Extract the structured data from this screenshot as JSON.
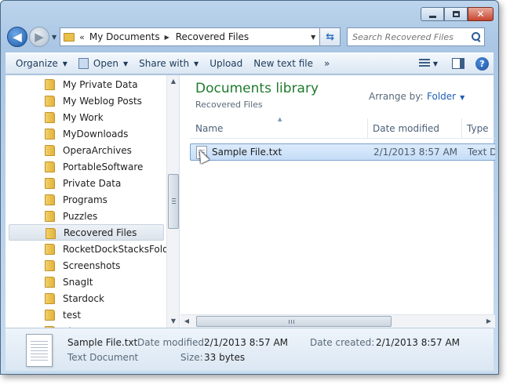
{
  "window": {
    "close_glyph": "✕"
  },
  "address": {
    "overflow": "«",
    "segments": [
      "My Documents",
      "Recovered Files"
    ],
    "separator": "▶"
  },
  "search": {
    "placeholder": "Search Recovered Files"
  },
  "toolbar": {
    "organize": "Organize",
    "open": "Open",
    "share_with": "Share with",
    "upload": "Upload",
    "new_text_file": "New text file",
    "more": "»",
    "help": "?"
  },
  "nav_tree": {
    "items": [
      "My Private Data",
      "My Weblog Posts",
      "My Work",
      "MyDownloads",
      "OperaArchives",
      "PortableSoftware",
      "Private Data",
      "Programs",
      "Puzzles",
      "Recovered Files",
      "RocketDockStacksFolders",
      "Screenshots",
      "SnagIt",
      "Stardock",
      "test",
      "TheCrea"
    ],
    "selected": "Recovered Files"
  },
  "library": {
    "title": "Documents library",
    "subtitle": "Recovered Files",
    "arrange_by_label": "Arrange by:",
    "arrange_by_value": "Folder"
  },
  "columns": {
    "name": "Name",
    "date_modified": "Date modified",
    "type": "Type"
  },
  "files": [
    {
      "name": "Sample File.txt",
      "date_modified": "2/1/2013 8:57 AM",
      "type": "Text Document"
    }
  ],
  "details_pane": {
    "name": "Sample File.txt",
    "type": "Text Document",
    "date_modified_label": "Date modified:",
    "date_modified": "2/1/2013 8:57 AM",
    "date_created_label": "Date created:",
    "date_created": "2/1/2013 8:57 AM",
    "size_label": "Size:",
    "size": "33 bytes"
  },
  "colors": {
    "library_title": "#1e7a2e",
    "link": "#1f5fb8",
    "selection": "#c5ddf8"
  }
}
